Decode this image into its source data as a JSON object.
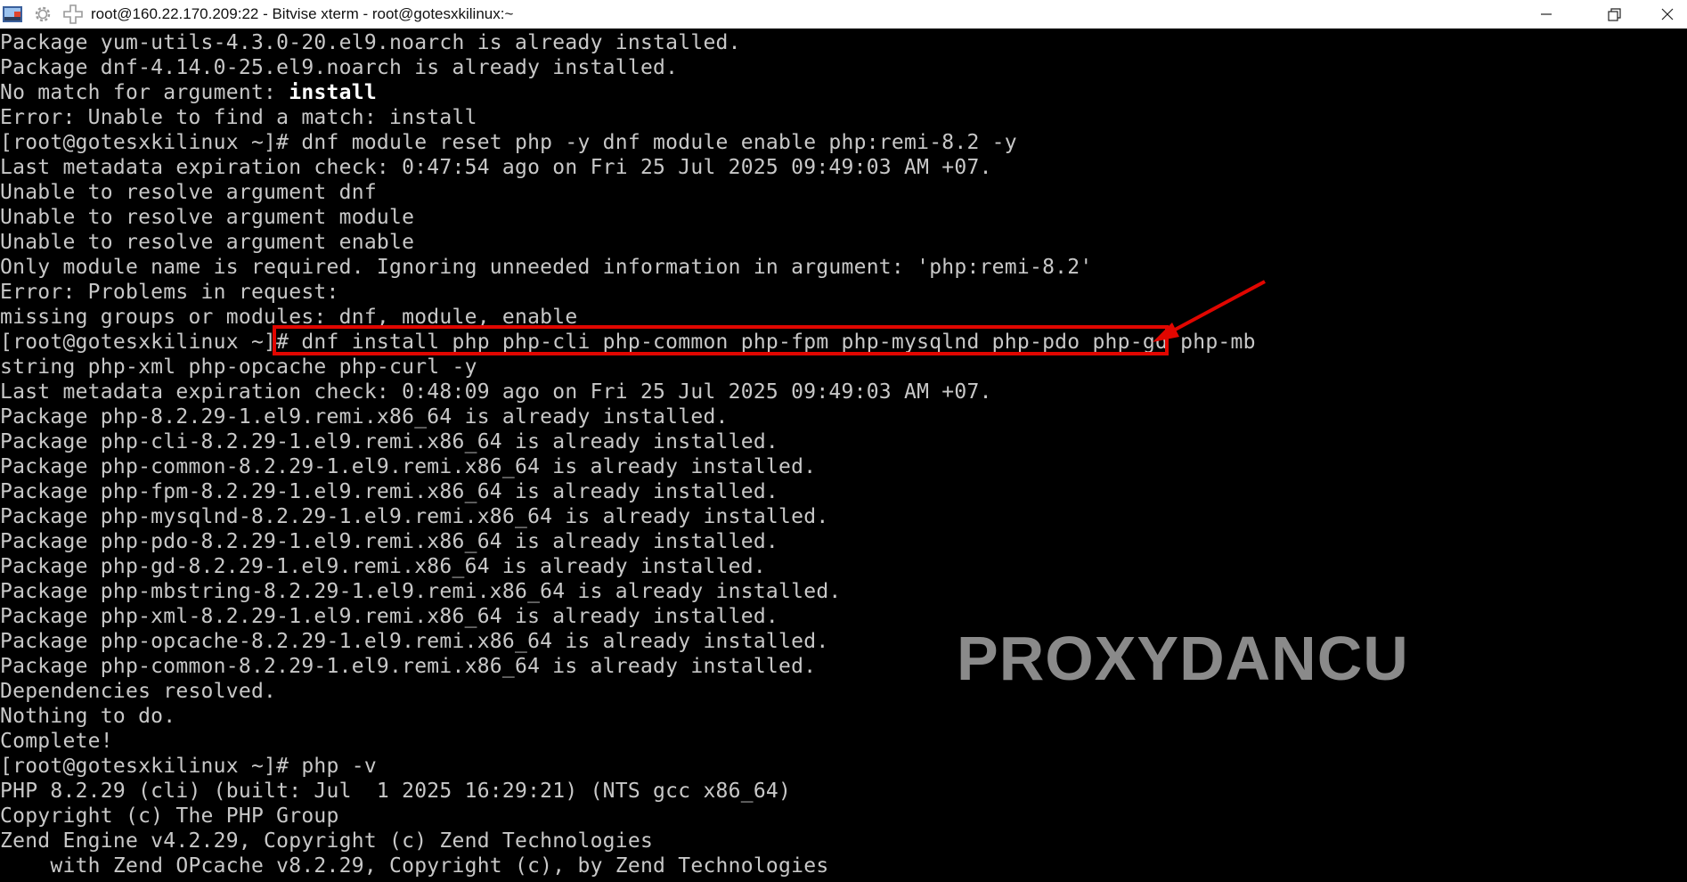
{
  "window": {
    "title": "root@160.22.170.209:22 - Bitvise xterm - root@gotesxkilinux:~",
    "icons": [
      "bitvise-app-icon",
      "gear-icon",
      "new-window-icon"
    ],
    "controls": [
      "minimize-icon",
      "restore-icon",
      "close-icon"
    ]
  },
  "colors": {
    "terminal_bg": "#000000",
    "terminal_fg": "#c8c8c8",
    "highlight": "#e10600",
    "watermark": "#8a8a8a"
  },
  "terminal": {
    "lines": [
      "Package yum-utils-4.3.0-20.el9.noarch is already installed.",
      "Package dnf-4.14.0-25.el9.noarch is already installed.",
      "No match for argument: ",
      "Error: Unable to find a match: install",
      "[root@gotesxkilinux ~]# dnf module reset php -y dnf module enable php:remi-8.2 -y",
      "Last metadata expiration check: 0:47:54 ago on Fri 25 Jul 2025 09:49:03 AM +07.",
      "Unable to resolve argument dnf",
      "Unable to resolve argument module",
      "Unable to resolve argument enable",
      "Only module name is required. Ignoring unneeded information in argument: 'php:remi-8.2'",
      "Error: Problems in request:",
      "missing groups or modules: dnf, module, enable",
      "[root@gotesxkilinux ~]# dnf install php php-cli php-common php-fpm php-mysqlnd php-pdo php-gd php-mb",
      "string php-xml php-opcache php-curl -y",
      "Last metadata expiration check: 0:48:09 ago on Fri 25 Jul 2025 09:49:03 AM +07.",
      "Package php-8.2.29-1.el9.remi.x86_64 is already installed.",
      "Package php-cli-8.2.29-1.el9.remi.x86_64 is already installed.",
      "Package php-common-8.2.29-1.el9.remi.x86_64 is already installed.",
      "Package php-fpm-8.2.29-1.el9.remi.x86_64 is already installed.",
      "Package php-mysqlnd-8.2.29-1.el9.remi.x86_64 is already installed.",
      "Package php-pdo-8.2.29-1.el9.remi.x86_64 is already installed.",
      "Package php-gd-8.2.29-1.el9.remi.x86_64 is already installed.",
      "Package php-mbstring-8.2.29-1.el9.remi.x86_64 is already installed.",
      "Package php-xml-8.2.29-1.el9.remi.x86_64 is already installed.",
      "Package php-opcache-8.2.29-1.el9.remi.x86_64 is already installed.",
      "Package php-common-8.2.29-1.el9.remi.x86_64 is already installed.",
      "Dependencies resolved.",
      "Nothing to do.",
      "Complete!",
      "[root@gotesxkilinux ~]# php -v",
      "PHP 8.2.29 (cli) (built: Jul  1 2025 16:29:21) (NTS gcc x86_64)",
      "Copyright (c) The PHP Group",
      "Zend Engine v4.2.29, Copyright (c) Zend Technologies",
      "    with Zend OPcache v8.2.29, Copyright (c), by Zend Technologies"
    ],
    "bold_word": "install"
  },
  "watermark": "PROXYDANCU"
}
